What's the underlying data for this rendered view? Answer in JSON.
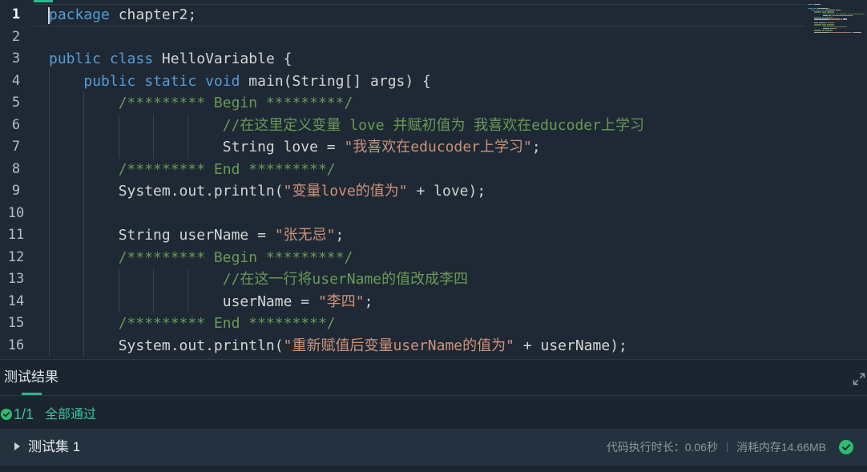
{
  "theme": {
    "editor_bg": "#1e2935",
    "panel_bg": "#1b2530",
    "row_bg": "#243240",
    "keyword": "#569cd6",
    "plain": "#d4d4d4",
    "comment": "#6a9955",
    "string": "#ce9178",
    "accent": "#2fb58c",
    "pass_text": "#3ec49b",
    "success_icon": "#2ebd6e",
    "muted_text": "#8c96a1"
  },
  "icons": {
    "expand": "expand-icon",
    "summary_status": "check-circle-icon",
    "test_set_toggle": "caret-right-icon",
    "test_set_status": "check-circle-icon"
  },
  "editor": {
    "lines": [
      {
        "number": "1",
        "current": true,
        "tokens": [
          {
            "type": "keyword",
            "text": "package"
          },
          {
            "type": "plain",
            "text": " chapter2;"
          }
        ]
      },
      {
        "number": "2",
        "tokens": []
      },
      {
        "number": "3",
        "tokens": [
          {
            "type": "keyword",
            "text": "public"
          },
          {
            "type": "plain",
            "text": " "
          },
          {
            "type": "keyword",
            "text": "class"
          },
          {
            "type": "plain",
            "text": " HelloVariable {"
          }
        ]
      },
      {
        "number": "4",
        "tokens": [
          {
            "type": "plain",
            "text": "    "
          },
          {
            "type": "keyword",
            "text": "public"
          },
          {
            "type": "plain",
            "text": " "
          },
          {
            "type": "keyword",
            "text": "static"
          },
          {
            "type": "plain",
            "text": " "
          },
          {
            "type": "keyword",
            "text": "void"
          },
          {
            "type": "plain",
            "text": " main(String[] args) {"
          }
        ]
      },
      {
        "number": "5",
        "tokens": [
          {
            "type": "plain",
            "text": "        "
          },
          {
            "type": "comment",
            "text": "/********* Begin *********/"
          }
        ]
      },
      {
        "number": "6",
        "tokens": [
          {
            "type": "plain",
            "text": "                    "
          },
          {
            "type": "comment",
            "text": "//在这里定义变量 love 并赋初值为 我喜欢在educoder上学习"
          }
        ]
      },
      {
        "number": "7",
        "tokens": [
          {
            "type": "plain",
            "text": "                    String love = "
          },
          {
            "type": "string",
            "text": "\"我喜欢在educoder上学习\""
          },
          {
            "type": "plain",
            "text": ";"
          }
        ]
      },
      {
        "number": "8",
        "tokens": [
          {
            "type": "plain",
            "text": "        "
          },
          {
            "type": "comment",
            "text": "/********* End *********/"
          }
        ]
      },
      {
        "number": "9",
        "tokens": [
          {
            "type": "plain",
            "text": "        System.out.println("
          },
          {
            "type": "string",
            "text": "\"变量love的值为\""
          },
          {
            "type": "plain",
            "text": " + love);"
          }
        ]
      },
      {
        "number": "10",
        "tokens": []
      },
      {
        "number": "11",
        "tokens": [
          {
            "type": "plain",
            "text": "        String userName = "
          },
          {
            "type": "string",
            "text": "\"张无忌\""
          },
          {
            "type": "plain",
            "text": ";"
          }
        ]
      },
      {
        "number": "12",
        "tokens": [
          {
            "type": "plain",
            "text": "        "
          },
          {
            "type": "comment",
            "text": "/********* Begin *********/"
          }
        ]
      },
      {
        "number": "13",
        "tokens": [
          {
            "type": "plain",
            "text": "                    "
          },
          {
            "type": "comment",
            "text": "//在这一行将userName的值改成李四"
          }
        ]
      },
      {
        "number": "14",
        "tokens": [
          {
            "type": "plain",
            "text": "                    userName = "
          },
          {
            "type": "string",
            "text": "\"李四\""
          },
          {
            "type": "plain",
            "text": ";"
          }
        ]
      },
      {
        "number": "15",
        "tokens": [
          {
            "type": "plain",
            "text": "        "
          },
          {
            "type": "comment",
            "text": "/********* End *********/"
          }
        ]
      },
      {
        "number": "16",
        "tokens": [
          {
            "type": "plain",
            "text": "        System.out.println("
          },
          {
            "type": "string",
            "text": "\"重新赋值后变量userName的值为\""
          },
          {
            "type": "plain",
            "text": " + userName);"
          }
        ]
      }
    ]
  },
  "results_panel": {
    "title": "测试结果",
    "summary": {
      "count": "1/1",
      "status": "全部通过"
    },
    "test_sets": [
      {
        "name": "测试集 1",
        "exec_time": "代码执行时长：0.06秒",
        "memory": "消耗内存14.66MB",
        "passed": true
      }
    ]
  }
}
